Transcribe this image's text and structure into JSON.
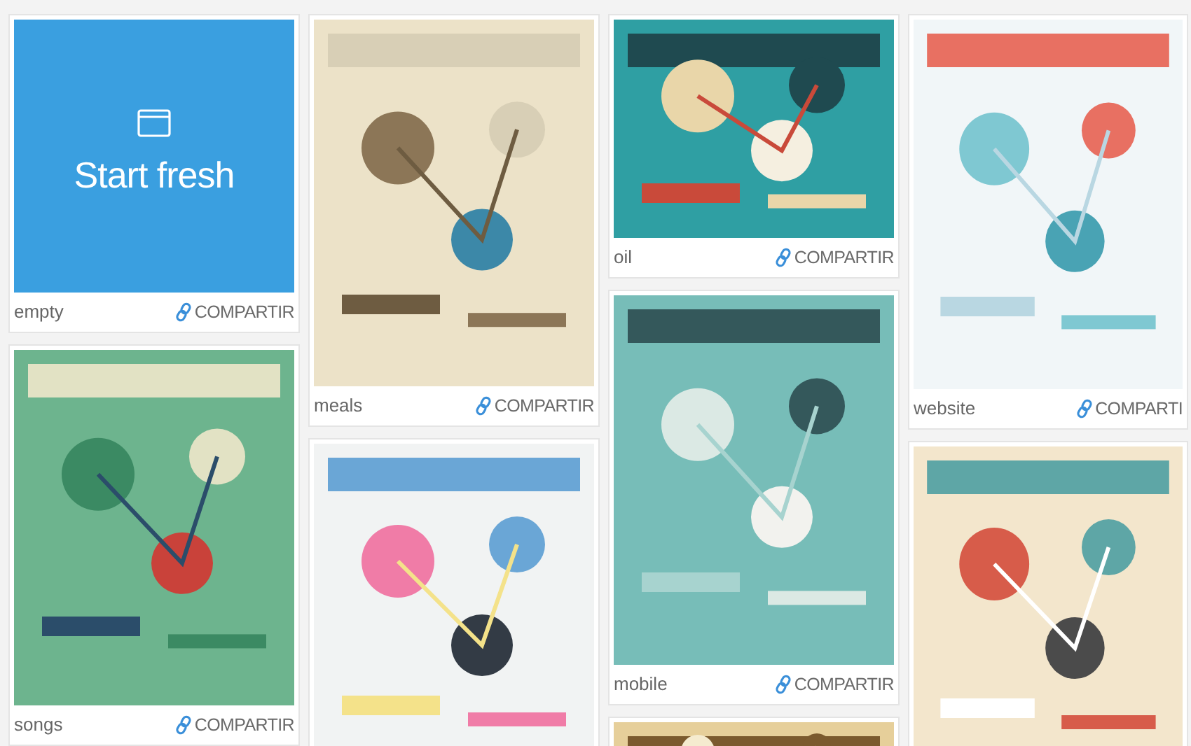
{
  "columns": [
    {
      "cards": [
        {
          "kind": "blank",
          "label": "Start fresh",
          "name": "empty",
          "share": "COMPARTIR"
        },
        {
          "kind": "picture",
          "name": "songs",
          "share": "COMPARTIR"
        }
      ]
    },
    {
      "cards": [
        {
          "kind": "picture",
          "name": "meals",
          "share": "COMPARTIR"
        },
        {
          "kind": "picture"
        }
      ]
    },
    {
      "cards": [
        {
          "kind": "picture",
          "name": "oil",
          "share": "COMPARTIR"
        },
        {
          "kind": "picture",
          "name": "mobile",
          "share": "COMPARTIR"
        },
        {
          "kind": "picture"
        }
      ]
    },
    {
      "cards": [
        {
          "kind": "picture",
          "name": "website",
          "share": "COMPARTI"
        },
        {
          "kind": "picture"
        }
      ]
    }
  ]
}
